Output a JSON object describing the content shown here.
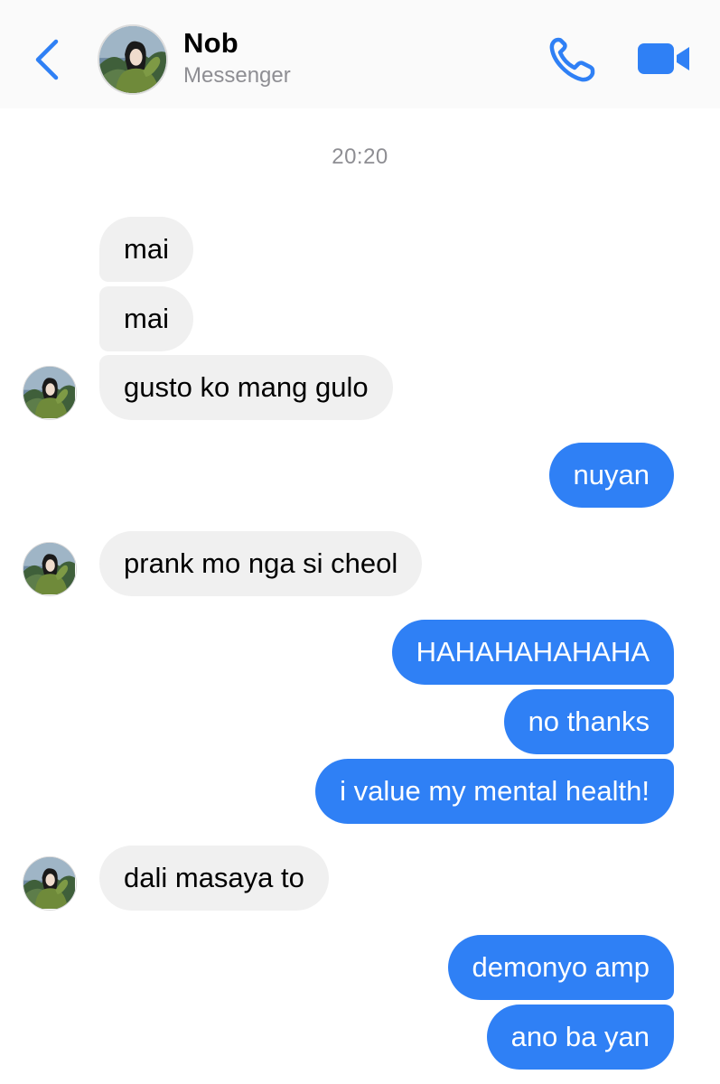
{
  "header": {
    "contact_name": "Nob",
    "contact_subtitle": "Messenger",
    "accent_color": "#2f80f5"
  },
  "icons": {
    "back": "chevron-left-icon",
    "call": "phone-icon",
    "video": "video-camera-icon"
  },
  "conversation": {
    "timestamp": "20:20",
    "messages": [
      {
        "sender": "Nob",
        "direction": "incoming",
        "text": "mai"
      },
      {
        "sender": "Nob",
        "direction": "incoming",
        "text": "mai"
      },
      {
        "sender": "Nob",
        "direction": "incoming",
        "text": "gusto ko mang gulo"
      },
      {
        "sender": "me",
        "direction": "outgoing",
        "text": "nuyan"
      },
      {
        "sender": "Nob",
        "direction": "incoming",
        "text": "prank mo nga si cheol"
      },
      {
        "sender": "me",
        "direction": "outgoing",
        "text": "HAHAHAHAHAHA"
      },
      {
        "sender": "me",
        "direction": "outgoing",
        "text": "no thanks"
      },
      {
        "sender": "me",
        "direction": "outgoing",
        "text": "i value my mental health!"
      },
      {
        "sender": "Nob",
        "direction": "incoming",
        "text": "dali masaya to"
      },
      {
        "sender": "me",
        "direction": "outgoing",
        "text": "demonyo amp"
      },
      {
        "sender": "me",
        "direction": "outgoing",
        "text": "ano ba yan"
      }
    ]
  },
  "colors": {
    "incoming_bubble": "#f0f0f0",
    "outgoing_bubble": "#2f80f5",
    "timestamp_text": "#8e8e93"
  }
}
